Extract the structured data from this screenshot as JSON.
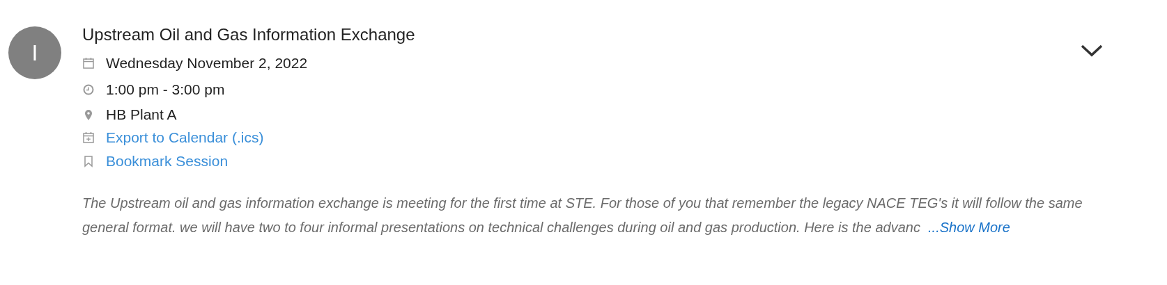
{
  "session": {
    "avatar_letter": "I",
    "title": "Upstream Oil and Gas Information Exchange",
    "details": [
      {
        "kind": "date",
        "text": "Wednesday November 2, 2022"
      },
      {
        "kind": "time",
        "text": "1:00 pm - 3:00 pm"
      },
      {
        "kind": "location",
        "text": "HB Plant A"
      },
      {
        "kind": "export",
        "text": "Export to Calendar (.ics)"
      },
      {
        "kind": "bookmark",
        "text": "Bookmark Session"
      }
    ],
    "description": "The Upstream oil and gas information exchange is meeting for the first time at STE. For those of you that remember the legacy NACE TEG's it will follow the same general format. we will have two to four informal presentations on technical challenges during oil and gas production. Here is the advanc",
    "show_more": "...Show More"
  }
}
